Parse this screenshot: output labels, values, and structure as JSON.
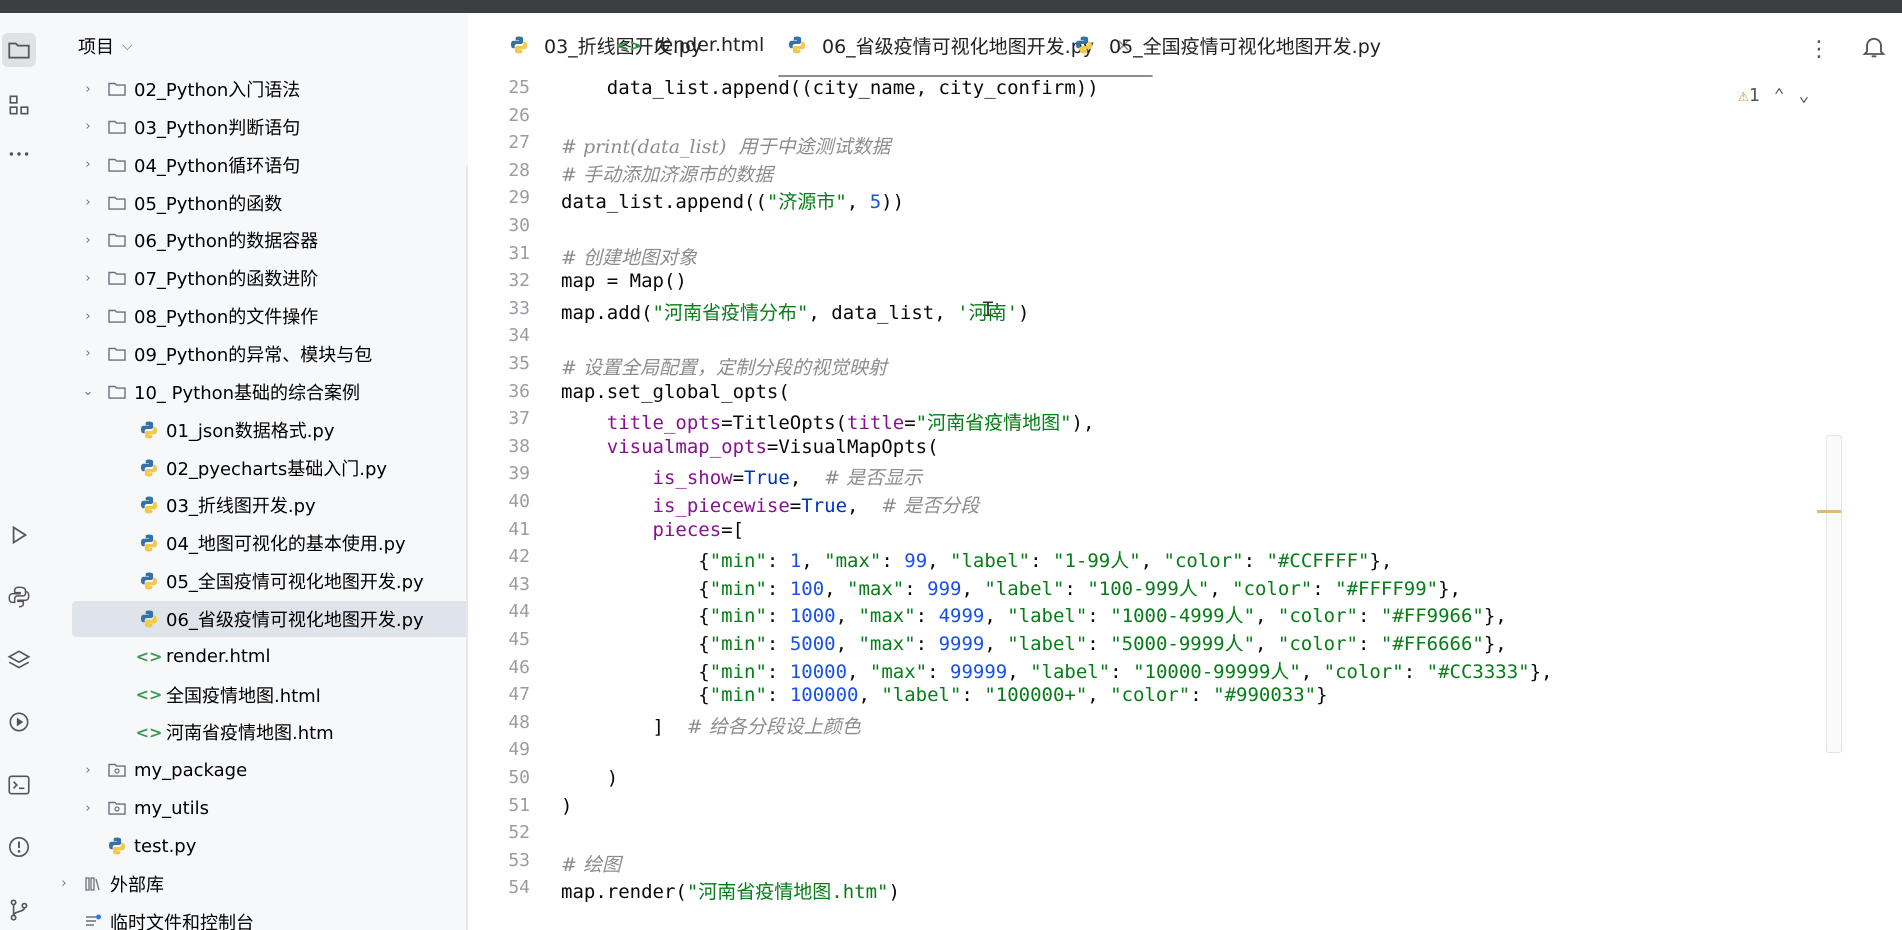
{
  "project_panel": {
    "title": "项目",
    "items": [
      {
        "label": "02_Python入门语法",
        "type": "folder",
        "depth": 1,
        "expandable": true
      },
      {
        "label": "03_Python判断语句",
        "type": "folder",
        "depth": 1,
        "expandable": true
      },
      {
        "label": "04_Python循环语句",
        "type": "folder",
        "depth": 1,
        "expandable": true
      },
      {
        "label": "05_Python的函数",
        "type": "folder",
        "depth": 1,
        "expandable": true
      },
      {
        "label": "06_Python的数据容器",
        "type": "folder",
        "depth": 1,
        "expandable": true
      },
      {
        "label": "07_Python的函数进阶",
        "type": "folder",
        "depth": 1,
        "expandable": true
      },
      {
        "label": "08_Python的文件操作",
        "type": "folder",
        "depth": 1,
        "expandable": true
      },
      {
        "label": "09_Python的异常、模块与包",
        "type": "folder",
        "depth": 1,
        "expandable": true
      },
      {
        "label": "10_ Python基础的综合案例",
        "type": "folder-open",
        "depth": 1,
        "expandable": true
      },
      {
        "label": "01_json数据格式.py",
        "type": "python",
        "depth": 2
      },
      {
        "label": "02_pyecharts基础入门.py",
        "type": "python",
        "depth": 2
      },
      {
        "label": "03_折线图开发.py",
        "type": "python",
        "depth": 2
      },
      {
        "label": "04_地图可视化的基本使用.py",
        "type": "python",
        "depth": 2
      },
      {
        "label": "05_全国疫情可视化地图开发.py",
        "type": "python",
        "depth": 2
      },
      {
        "label": "06_省级疫情可视化地图开发.py",
        "type": "python",
        "depth": 2,
        "selected": true
      },
      {
        "label": "render.html",
        "type": "html",
        "depth": 2
      },
      {
        "label": "全国疫情地图.html",
        "type": "html",
        "depth": 2
      },
      {
        "label": "河南省疫情地图.htm",
        "type": "html",
        "depth": 2
      },
      {
        "label": "my_package",
        "type": "package",
        "depth": 1,
        "expandable": true
      },
      {
        "label": "my_utils",
        "type": "package",
        "depth": 1,
        "expandable": true
      },
      {
        "label": "test.py",
        "type": "python",
        "depth": 1
      },
      {
        "label": "外部库",
        "type": "library",
        "depth": 0,
        "expandable": true
      },
      {
        "label": "临时文件和控制台",
        "type": "scratch",
        "depth": 0
      }
    ]
  },
  "tabs": [
    {
      "label": "03_折线图开发.py",
      "icon": "python-file-icon"
    },
    {
      "label": "render.html",
      "icon": "html-file-icon"
    },
    {
      "label": "06_省级疫情可视化地图开发.py",
      "icon": "python-file-icon",
      "active": true
    },
    {
      "label": "05_全国疫情可视化地图开发.py",
      "icon": "python-file-icon"
    }
  ],
  "editor": {
    "warning_count": "1",
    "lines": [
      {
        "n": "25",
        "html": "    data_list.append((city_name, city_confirm))"
      },
      {
        "n": "26",
        "html": ""
      },
      {
        "n": "27",
        "html": "<span class=\"cm\"># print(data_list)  用于中途测试数据</span>"
      },
      {
        "n": "28",
        "html": "<span class=\"cm\"># 手动添加济源市的数据</span>"
      },
      {
        "n": "29",
        "html": "data_list.append((<span class=\"st\">\"济源市\"</span>, <span class=\"nm\">5</span>))"
      },
      {
        "n": "30",
        "html": ""
      },
      {
        "n": "31",
        "html": "<span class=\"cm\"># 创建地图对象</span>"
      },
      {
        "n": "32",
        "html": "map = Map()"
      },
      {
        "n": "33",
        "html": "map.add(<span class=\"st\">\"河南省疫情分布\"</span>, data_list, <span class=\"st\">'河南'</span>)"
      },
      {
        "n": "34",
        "html": ""
      },
      {
        "n": "35",
        "html": "<span class=\"cm\"># 设置全局配置，定制分段的视觉映射</span>"
      },
      {
        "n": "36",
        "html": "map.set_global_opts("
      },
      {
        "n": "37",
        "html": "    <span class=\"pm\">title_opts</span>=TitleOpts(<span class=\"pm\">title</span>=<span class=\"st\">\"河南省疫情地图\"</span>),"
      },
      {
        "n": "38",
        "html": "    <span class=\"pm\">visualmap_opts</span>=VisualMapOpts("
      },
      {
        "n": "39",
        "html": "        <span class=\"pm\">is_show</span>=<span class=\"kw\">True</span>,  <span class=\"cm\"># 是否显示</span>"
      },
      {
        "n": "40",
        "html": "        <span class=\"pm\">is_piecewise</span>=<span class=\"kw\">True</span>,  <span class=\"cm\"># 是否分段</span>"
      },
      {
        "n": "41",
        "html": "        <span class=\"pm\">pieces</span>=["
      },
      {
        "n": "42",
        "html": "            {<span class=\"st\">\"min\"</span>: <span class=\"nm\">1</span>, <span class=\"st\">\"max\"</span>: <span class=\"nm\">99</span>, <span class=\"st\">\"label\"</span>: <span class=\"st\">\"1-99人\"</span>, <span class=\"st\">\"color\"</span>: <span class=\"st\">\"#CCFFFF\"</span>},"
      },
      {
        "n": "43",
        "html": "            {<span class=\"st\">\"min\"</span>: <span class=\"nm\">100</span>, <span class=\"st\">\"max\"</span>: <span class=\"nm\">999</span>, <span class=\"st\">\"label\"</span>: <span class=\"st\">\"100-999人\"</span>, <span class=\"st\">\"color\"</span>: <span class=\"st\">\"#FFFF99\"</span>},"
      },
      {
        "n": "44",
        "html": "            {<span class=\"st\">\"min\"</span>: <span class=\"nm\">1000</span>, <span class=\"st\">\"max\"</span>: <span class=\"nm\">4999</span>, <span class=\"st\">\"label\"</span>: <span class=\"st\">\"1000-4999人\"</span>, <span class=\"st\">\"color\"</span>: <span class=\"st\">\"#FF9966\"</span>},"
      },
      {
        "n": "45",
        "html": "            {<span class=\"st\">\"min\"</span>: <span class=\"nm\">5000</span>, <span class=\"st\">\"max\"</span>: <span class=\"nm\">9999</span>, <span class=\"st\">\"label\"</span>: <span class=\"st\">\"5000-9999人\"</span>, <span class=\"st\">\"color\"</span>: <span class=\"st\">\"#FF6666\"</span>},"
      },
      {
        "n": "46",
        "html": "            {<span class=\"st\">\"min\"</span>: <span class=\"nm\">10000</span>, <span class=\"st\">\"max\"</span>: <span class=\"nm\">99999</span>, <span class=\"st\">\"label\"</span>: <span class=\"st\">\"10000-99999人\"</span>, <span class=\"st\">\"color\"</span>: <span class=\"st\">\"#CC3333\"</span>},"
      },
      {
        "n": "47",
        "html": "            {<span class=\"st\">\"min\"</span>: <span class=\"nm\">100000</span>, <span class=\"st\">\"label\"</span>: <span class=\"st\">\"100000+\"</span>, <span class=\"st\">\"color\"</span>: <span class=\"st\">\"#990033\"</span>}"
      },
      {
        "n": "48",
        "html": "        ]  <span class=\"cm\"># 给各分段设上颜色</span>"
      },
      {
        "n": "49",
        "html": ""
      },
      {
        "n": "50",
        "html": "    )"
      },
      {
        "n": "51",
        "html": ")"
      },
      {
        "n": "52",
        "html": ""
      },
      {
        "n": "53",
        "html": "<span class=\"cm\"># 绘图</span>"
      },
      {
        "n": "54",
        "html": "map.render(<span class=\"st\">\"河南省疫情地图.htm\"</span>)"
      }
    ]
  }
}
